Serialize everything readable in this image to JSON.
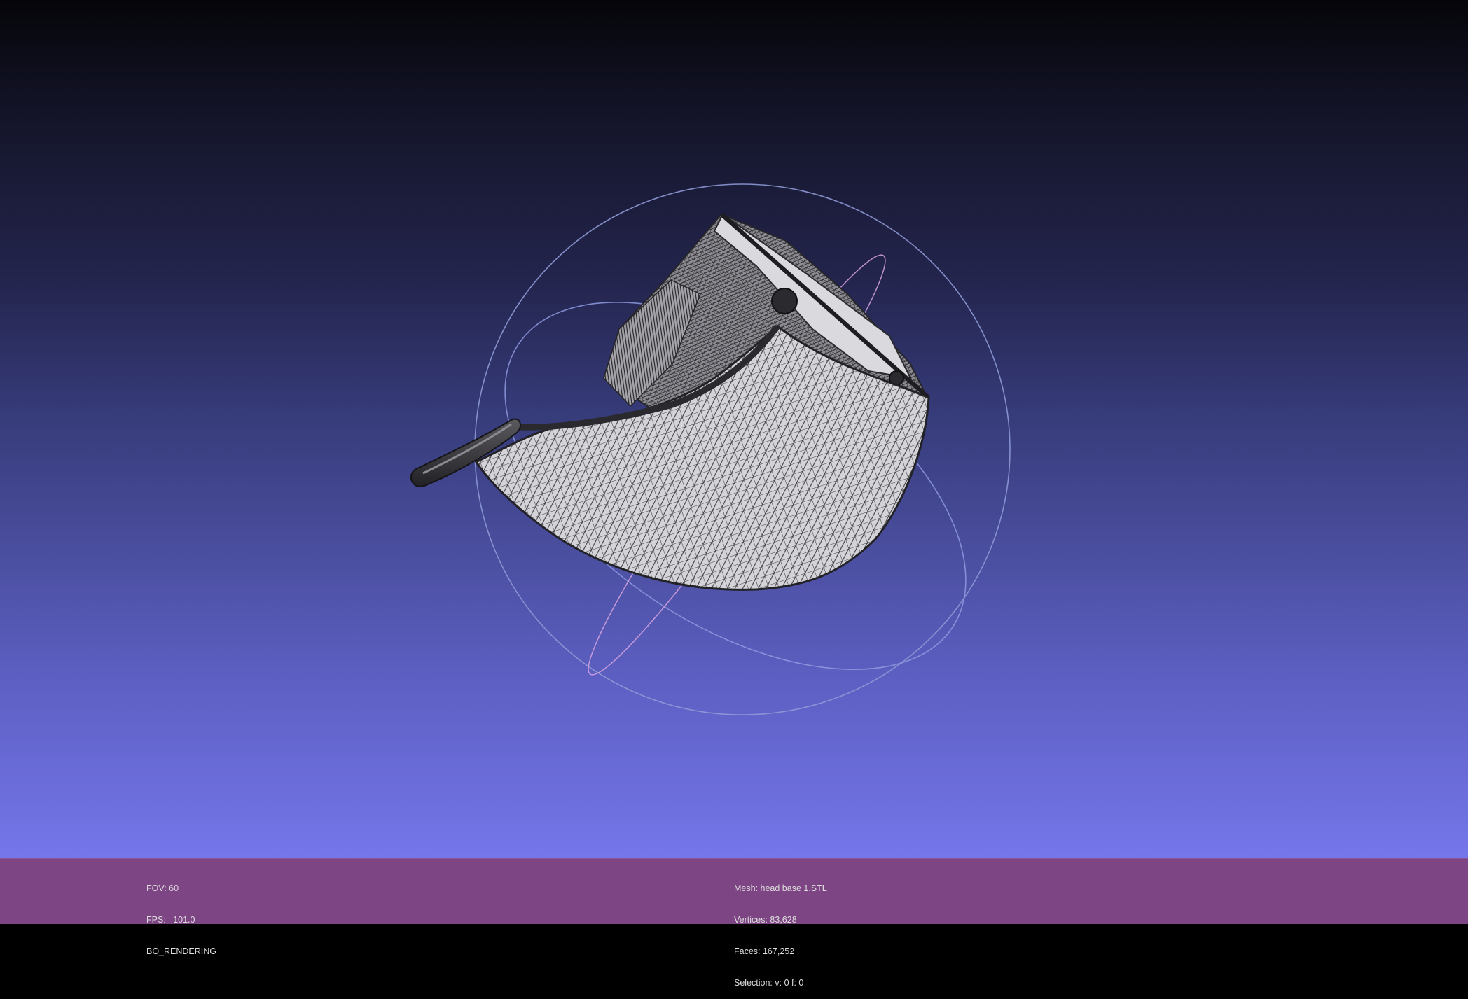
{
  "viewer": {
    "mesh_object": "head base 1 STL"
  },
  "info_left": {
    "fov": "FOV: 60",
    "fps": "FPS:   101.0",
    "render_mode": "BO_RENDERING"
  },
  "info_center": {
    "mesh": "Mesh: head base 1.STL",
    "vertices": "Vertices: 83,628",
    "faces": "Faces: 167,252",
    "selection": "Selection: v: 0 f: 0"
  },
  "colors": {
    "background_top": "#050509",
    "background_bottom": "#7576ea",
    "info_bar": "#7e4584",
    "info_text": "#dedede",
    "mesh_face": "#d4d4d8",
    "mesh_wire": "#2a2a2e",
    "trackball_ring": "#8e9ad6",
    "trackball_axis": "#d9a6e0"
  },
  "icons": {
    "trackball": "trackball-gizmo"
  }
}
